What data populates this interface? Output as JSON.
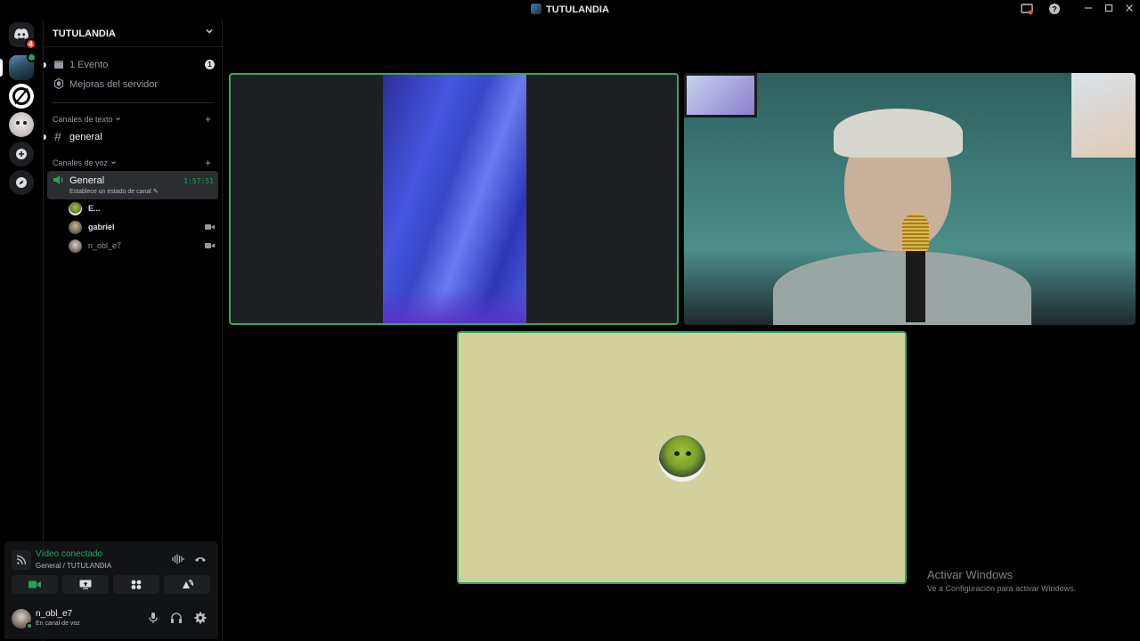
{
  "window": {
    "title": "TUTULANDIA",
    "buttons": [
      "minimize",
      "maximize",
      "close"
    ]
  },
  "server_rail": {
    "notification_count": "4",
    "servers": [
      "discord-home",
      "tutulandia",
      "server-2",
      "server-3",
      "add-server",
      "explore"
    ]
  },
  "server": {
    "name": "TUTULANDIA"
  },
  "sidebar": {
    "events_label": "1 Evento",
    "events_count": "1",
    "boost_label": "Mejoras del servidor",
    "text_category": "Canales de texto",
    "text_channel": "general",
    "voice_category": "Canales de voz",
    "voice_channel": {
      "name": "General",
      "timer": "1:57:51",
      "status_placeholder": "Establece un estado de canal"
    },
    "voice_users": [
      {
        "name": "E...",
        "camera": false
      },
      {
        "name": "gabriel",
        "camera": true
      },
      {
        "name": "n_obl_e7",
        "camera": true
      }
    ]
  },
  "voice_panel": {
    "state": "Vídeo conectado",
    "location": "General / TUTULANDIA",
    "actions": [
      "camera",
      "screen-share",
      "activities",
      "soundboard"
    ]
  },
  "user_panel": {
    "username": "n_obl_e7",
    "status": "En canal de voz"
  },
  "tiles": [
    {
      "type": "video",
      "speaking": true
    },
    {
      "type": "video",
      "speaking": false
    },
    {
      "type": "avatar",
      "speaking": true
    }
  ],
  "watermark": {
    "line1": "Activar Windows",
    "line2": "Ve a Configuración para activar Windows."
  },
  "colors": {
    "accent_green": "#23a55a",
    "speaking_border": "#3ba55d",
    "background": "#000000"
  }
}
